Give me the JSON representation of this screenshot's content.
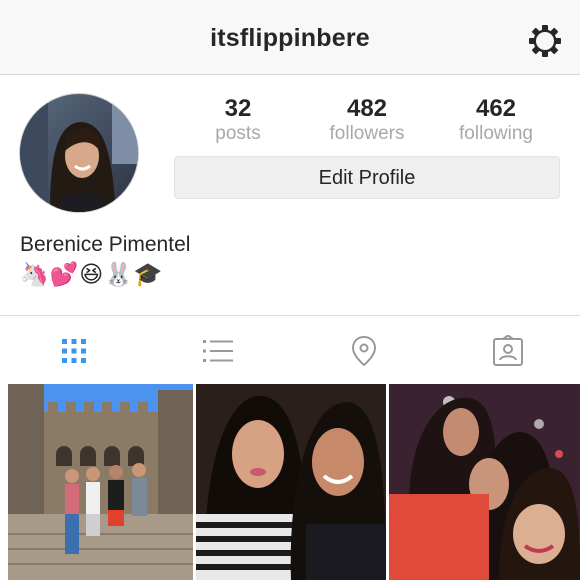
{
  "header": {
    "username": "itsflippinbere",
    "settings_icon": "gear-icon"
  },
  "profile": {
    "avatar_icon": "profile-photo",
    "stats": [
      {
        "count": "32",
        "label": "posts"
      },
      {
        "count": "482",
        "label": "followers"
      },
      {
        "count": "462",
        "label": "following"
      }
    ],
    "edit_button_label": "Edit Profile",
    "full_name": "Berenice Pimentel",
    "bio": "🦄💕😆🐰🎓"
  },
  "tabs": [
    {
      "name": "grid-view",
      "icon": "grid-icon",
      "active": true
    },
    {
      "name": "list-view",
      "icon": "list-icon",
      "active": false
    },
    {
      "name": "map-view",
      "icon": "location-pin-icon",
      "active": false
    },
    {
      "name": "tagged-view",
      "icon": "tagged-photos-icon",
      "active": false
    }
  ],
  "colors": {
    "accent": "#3897f0",
    "text": "#262626",
    "muted": "#a8a8a8",
    "inactive_icon": "#999999",
    "header_bg": "#f8f8f8"
  },
  "posts": [
    {
      "subject": "photo-castle-group"
    },
    {
      "subject": "photo-two-friends"
    },
    {
      "subject": "photo-night-selfie"
    }
  ]
}
